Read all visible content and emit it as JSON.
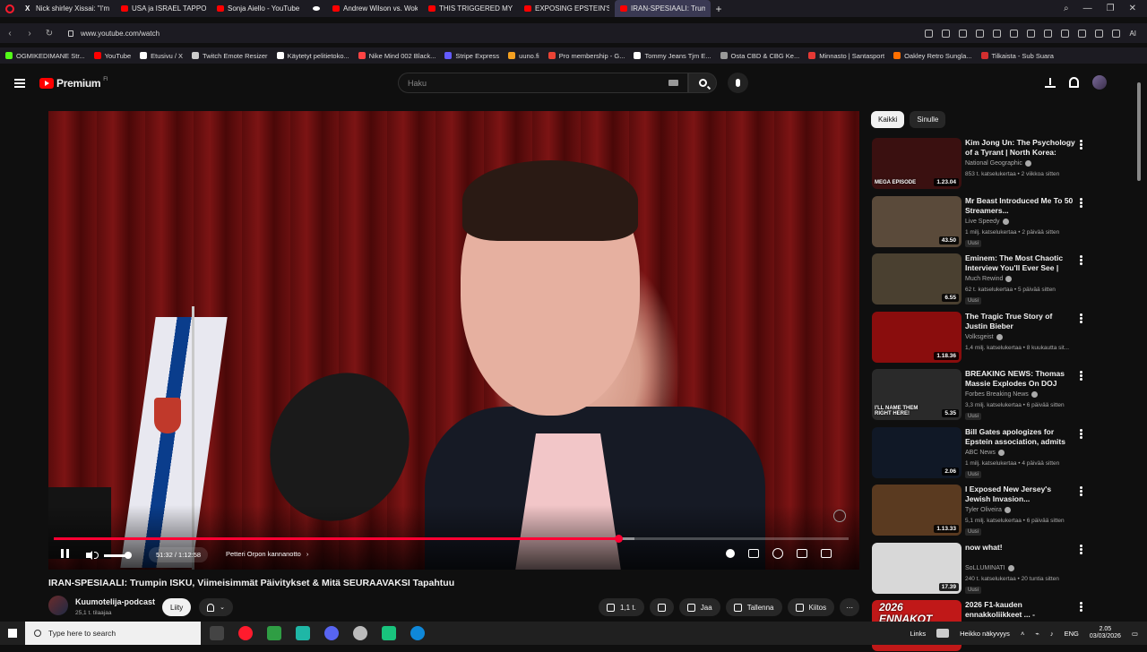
{
  "browser": {
    "tabs": [
      {
        "label": "Nick shirley Xissai: \"I'm fr",
        "icon": "x-icon",
        "active": false
      },
      {
        "label": "USA ja ISRAEL TAPPONAT",
        "icon": "youtube-icon",
        "active": false
      },
      {
        "label": "Sonja Aiello - YouTube",
        "icon": "youtube-icon",
        "active": false
      },
      {
        "label": "",
        "icon": "dot-icon",
        "active": false
      },
      {
        "label": "Andrew Wilson vs. Woke",
        "icon": "youtube-icon",
        "active": false
      },
      {
        "label": "THIS TRIGGERED MY BIGG",
        "icon": "youtube-icon",
        "active": false
      },
      {
        "label": "EXPOSING EPSTEIN'S ZOR",
        "icon": "youtube-icon",
        "active": false
      },
      {
        "label": "IRAN-SPESIAALI: Trum",
        "icon": "youtube-icon",
        "active": true
      }
    ],
    "new_tab": "+",
    "url": "www.youtube.com/watch",
    "ai_label": "AI",
    "bookmarks": [
      {
        "label": "OGMIKEDIMANE Str...",
        "color": "#53fc18"
      },
      {
        "label": "YouTube",
        "color": "#ff0000"
      },
      {
        "label": "Etusivu / X",
        "color": "#ffffff"
      },
      {
        "label": "Twitch Emote Resizer",
        "color": "#cccccc"
      },
      {
        "label": "Käytetyt pelitietoko...",
        "color": "#ffffff"
      },
      {
        "label": "Nike Mind 002 Black...",
        "color": "#ff4444"
      },
      {
        "label": "Stripe Express",
        "color": "#635bff"
      },
      {
        "label": "uuno.fi",
        "color": "#f4a020"
      },
      {
        "label": "Pro membership - G...",
        "color": "#ea4335"
      },
      {
        "label": "Tommy Jeans Tjm E...",
        "color": "#ffffff"
      },
      {
        "label": "Osta CBD & CBG Ke...",
        "color": "#999999"
      },
      {
        "label": "Minnasto | Santasport",
        "color": "#e53935"
      },
      {
        "label": "Oakley Retro Sungla...",
        "color": "#ff6f00"
      },
      {
        "label": "Tilkaista - Sub Suara",
        "color": "#d32f2f"
      }
    ]
  },
  "youtube": {
    "logo_text": "Premium",
    "country_code": "FI",
    "search_placeholder": "Haku",
    "player": {
      "progress_fraction": 0.71,
      "buffer_fraction": 0.73,
      "time": "51:32 / 1:12:58",
      "chapter": "Petteri Orpon kannanotto",
      "chapter_arrow": "›"
    },
    "video_title": "IRAN-SPESIAALI: Trumpin ISKU, Viimeisimmät Päivitykset & Mitä SEURAAVAKSI Tapahtuu",
    "channel": {
      "name": "Kuumotelija-podcast",
      "subs": "25,1 t. tilaajaa",
      "join_label": "Liity"
    },
    "actions": {
      "likes": "1,1 t.",
      "share": "Jaa",
      "save": "Tallenna",
      "thanks": "Kiitos"
    },
    "chips": [
      "Kaikki",
      "Sinulle"
    ],
    "recommendations": [
      {
        "title": "Kim Jong Un: The Psychology of a Tyrant | North Korea: Insi...",
        "channel": "National Geographic",
        "meta": "853 t. katselukertaa • 2 viikkoa sitten",
        "duration": "1.23.04",
        "badge": "",
        "thumb_text": "MEGA EPISODE",
        "thumb_color": "#3a1010"
      },
      {
        "title": "Mr Beast Introduced Me To 50 Streamers...",
        "channel": "Live Speedy",
        "meta": "1 milj. katselukertaa • 2 päivää sitten",
        "duration": "43.50",
        "badge": "Uusi",
        "thumb_text": "",
        "thumb_color": "#5a4a3a"
      },
      {
        "title": "Eminem: The Most Chaotic Interview You'll Ever See | Mu...",
        "channel": "Much Rewind",
        "meta": "62 t. katselukertaa • 5 päivää sitten",
        "duration": "6.55",
        "badge": "Uusi",
        "thumb_text": "",
        "thumb_color": "#4a4030"
      },
      {
        "title": "The Tragic True Story of Justin Bieber",
        "channel": "Volksgeist",
        "meta": "1,4 milj. katselukertaa • 8 kuukautta sit...",
        "duration": "1.18.36",
        "badge": "",
        "thumb_text": "",
        "thumb_color": "#8a0d0d"
      },
      {
        "title": "BREAKING NEWS: Thomas Massie Explodes On DOJ Ove...",
        "channel": "Forbes Breaking News",
        "meta": "3,3 milj. katselukertaa • 6 päivää sitten",
        "duration": "5.35",
        "badge": "Uusi",
        "thumb_text": "I'LL NAME THEM RIGHT HERE!",
        "thumb_color": "#2a2a2a"
      },
      {
        "title": "Bill Gates apologizes for Epstein association, admits to...",
        "channel": "ABC News",
        "meta": "1 milj. katselukertaa • 4 päivää sitten",
        "duration": "2.06",
        "badge": "Uusi",
        "thumb_text": "",
        "thumb_color": "#101826"
      },
      {
        "title": "I Exposed New Jersey's Jewish Invasion...",
        "channel": "Tyler Oliveira",
        "meta": "5,1 milj. katselukertaa • 6 päivää sitten",
        "duration": "1.13.33",
        "badge": "Uusi",
        "thumb_text": "",
        "thumb_color": "#5a3a20"
      },
      {
        "title": "now what!",
        "channel": "SoLLUMINATI",
        "meta": "240 t. katselukertaa • 20 tuntia sitten",
        "duration": "17.39",
        "badge": "Uusi",
        "thumb_text": "",
        "thumb_color": "#d8d8d8"
      },
      {
        "title": "2026 F1-kauden ennakkoliikkeet ... -",
        "channel": "",
        "meta": "",
        "duration": "",
        "badge": "",
        "thumb_text": "2026 ENNAKOT",
        "thumb_color": "#c01818"
      }
    ]
  },
  "taskbar": {
    "search_placeholder": "Type here to search",
    "links": "Links",
    "weather": "Heikko näkyvyys",
    "lang": "ENG",
    "time": "2.05",
    "date": "03/03/2026"
  },
  "colors": {
    "accent": "#ff0033",
    "background": "#0f0f0f"
  }
}
